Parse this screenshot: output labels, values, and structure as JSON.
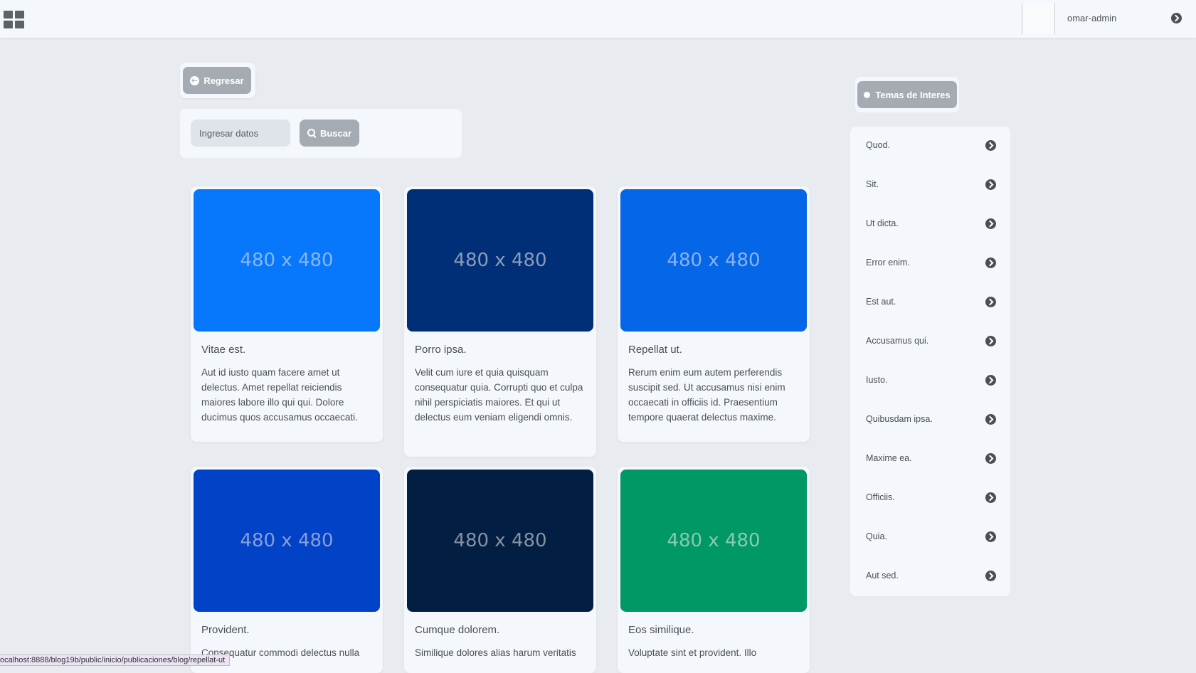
{
  "navbar": {
    "username": "omar-admin",
    "menu_icon": "grid-icon",
    "user_menu_icon": "chevron-right-circle-icon"
  },
  "back_button": {
    "label": "Regresar",
    "icon": "arrow-left-circle-icon"
  },
  "search": {
    "placeholder": "Ingresar datos",
    "value": "",
    "button_label": "Buscar",
    "button_icon": "search-icon"
  },
  "posts": [
    {
      "image_text": "480 x 480",
      "image_color": "#0778fb",
      "title": "Vitae est.",
      "body": "Aut id iusto quam facere amet ut delectus. Amet repellat reiciendis maiores labore illo qui qui. Dolore ducimus quos accusamus occaecati."
    },
    {
      "image_text": "480 x 480",
      "image_color": "#002f77",
      "title": "Porro ipsa.",
      "body": "Velit cum iure et quia quisquam consequatur quia. Corrupti quo et culpa nihil perspiciatis maiores. Et qui ut delectus eum veniam eligendi omnis."
    },
    {
      "image_text": "480 x 480",
      "image_color": "#0666e8",
      "title": "Repellat ut.",
      "body": "Rerum enim eum autem perferendis suscipit sed. Ut accusamus nisi enim occaecati in officiis id. Praesentium tempore quaerat delectus maxime."
    },
    {
      "image_text": "480 x 480",
      "image_color": "#0242c6",
      "title": "Provident.",
      "body": "Consequatur commodi delectus nulla"
    },
    {
      "image_text": "480 x 480",
      "image_color": "#021e42",
      "title": "Cumque dolorem.",
      "body": "Similique dolores alias harum veritatis"
    },
    {
      "image_text": "480 x 480",
      "image_color": "#009864",
      "title": "Eos similique.",
      "body": "Voluptate sint et provident. Illo"
    }
  ],
  "sidebar": {
    "title": "Temas de Interes",
    "title_icon": "dot-icon",
    "item_icon": "chevron-right-circle-icon",
    "items": [
      "Quod.",
      "Sit.",
      "Ut dicta.",
      "Error enim.",
      "Est aut.",
      "Accusamus qui.",
      "Iusto.",
      "Quibusdam ipsa.",
      "Maxime ea.",
      "Officiis.",
      "Quia.",
      "Aut sed."
    ]
  },
  "status_bar": {
    "url": "ocalhost:8888/blog19b/public/inicio/publicaciones/blog/repellat-ut"
  }
}
